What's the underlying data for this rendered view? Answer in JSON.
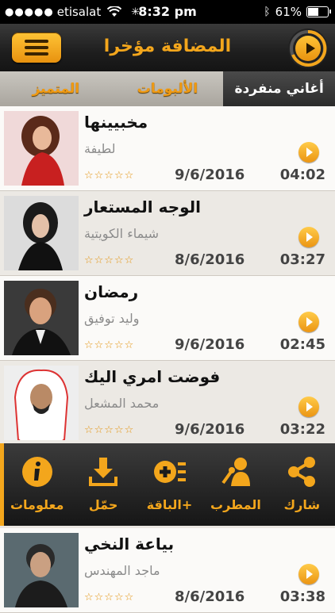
{
  "status_bar": {
    "signal": "●●●●●",
    "carrier": "etisalat",
    "time": "8:32 pm",
    "battery": "61%",
    "battery_level": 0.61
  },
  "header": {
    "title": "المضافة مؤخرا"
  },
  "tabs": [
    {
      "label": "المتميز"
    },
    {
      "label": "الألبومات"
    },
    {
      "label": "أغاني منفردة"
    }
  ],
  "songs": [
    {
      "title": "مخبيينها",
      "artist": "لطيفة",
      "rating": "☆☆☆☆☆",
      "date": "9/6/2016",
      "duration": "04:02"
    },
    {
      "title": "الوجه المستعار",
      "artist": "شيماء الكويتية",
      "rating": "☆☆☆☆☆",
      "date": "8/6/2016",
      "duration": "03:27"
    },
    {
      "title": "رمضان",
      "artist": "وليد توفيق",
      "rating": "☆☆☆☆☆",
      "date": "9/6/2016",
      "duration": "02:45"
    },
    {
      "title": "فوضت امري اليك",
      "artist": "محمد المشعل",
      "rating": "☆☆☆☆☆",
      "date": "9/6/2016",
      "duration": "03:22"
    },
    {
      "title": "بياعة النخي",
      "artist": "ماجد المهندس",
      "rating": "☆☆☆☆☆",
      "date": "8/6/2016",
      "duration": "03:38"
    }
  ],
  "actions": [
    {
      "label": "معلومات",
      "icon": "info-icon"
    },
    {
      "label": "حمّل",
      "icon": "download-icon"
    },
    {
      "label": "الباقة+",
      "icon": "add-to-playlist-icon"
    },
    {
      "label": "المطرب",
      "icon": "singer-icon"
    },
    {
      "label": "شارك",
      "icon": "share-icon"
    }
  ],
  "colors": {
    "accent": "#f3a61c",
    "header_bg": "#1e1e1e",
    "tab_active": "#2b2b2b",
    "star": "#e39410"
  }
}
